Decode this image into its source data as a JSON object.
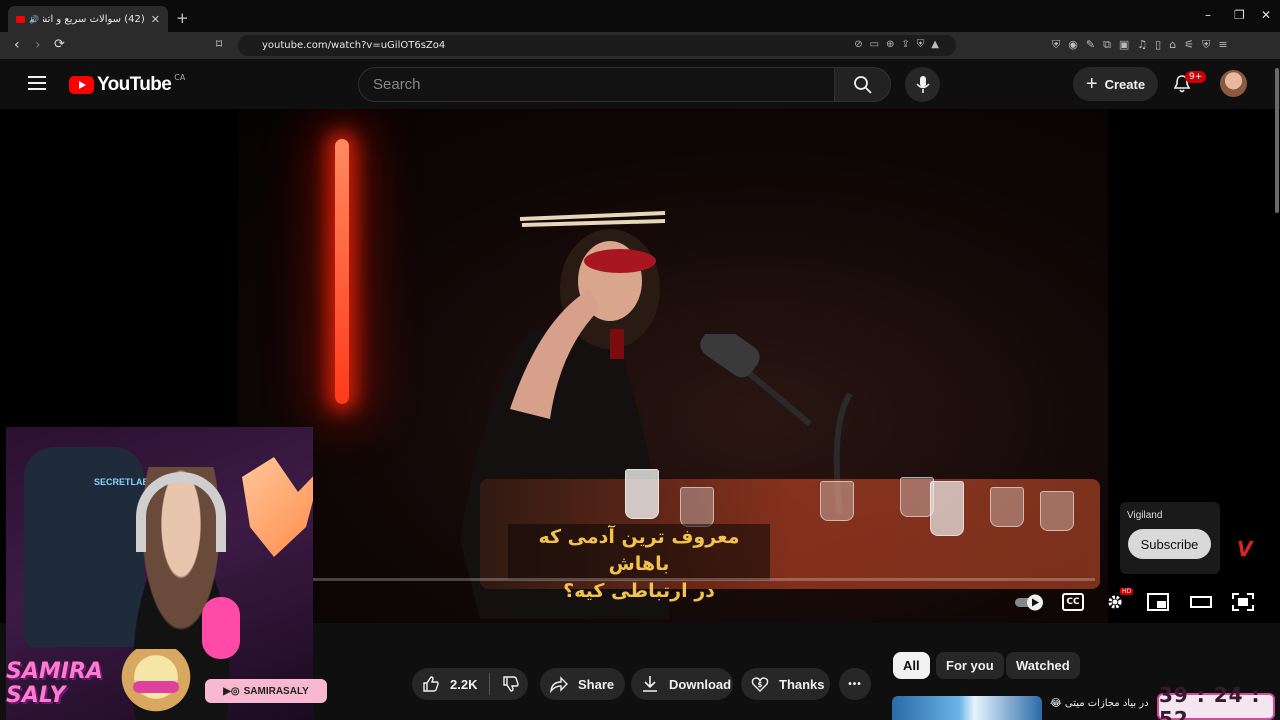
{
  "browser": {
    "tab_title": "(42) سوالات سریع و آتشین با یـ",
    "tab_close": "✕",
    "new_tab": "+",
    "url": "youtube.com/watch?v=uGilOT6sZo4",
    "window_min": "–",
    "window_max": "❐",
    "window_close": "✕"
  },
  "masthead": {
    "logo_text": "YouTube",
    "country": "CA",
    "search_placeholder": "Search",
    "create_label": "Create",
    "notifications_badge": "9+"
  },
  "player": {
    "subtitle_line1": "معروف ترین آدمی که باهاش",
    "subtitle_line2": "در ارتباطی کیه؟",
    "channel_watermark": "Vigiland",
    "subscribe_label": "Subscribe",
    "cc_label": "CC",
    "hd_badge": "HD"
  },
  "actions": {
    "like_count": "2.2K",
    "share_label": "Share",
    "download_label": "Download",
    "thanks_label": "Thanks",
    "more_label": "•••"
  },
  "filters": {
    "chips": [
      "All",
      "For you",
      "Watched"
    ],
    "active": "All"
  },
  "recommendation": {
    "title": "در بیاد مجازات میتی 😂"
  },
  "overlay": {
    "streamer_name_line1": "SAMIRA",
    "streamer_name_line2": "SALY",
    "social_handle": "SAMIRASALY",
    "chair_brand": "SECRETLAB",
    "timer": "39 : 24 : 52"
  },
  "colors": {
    "background": "#0f0f0f",
    "accent_red": "#ff0000",
    "subtitle_yellow": "#f2c14e",
    "overlay_pink": "#ff7ad0"
  }
}
